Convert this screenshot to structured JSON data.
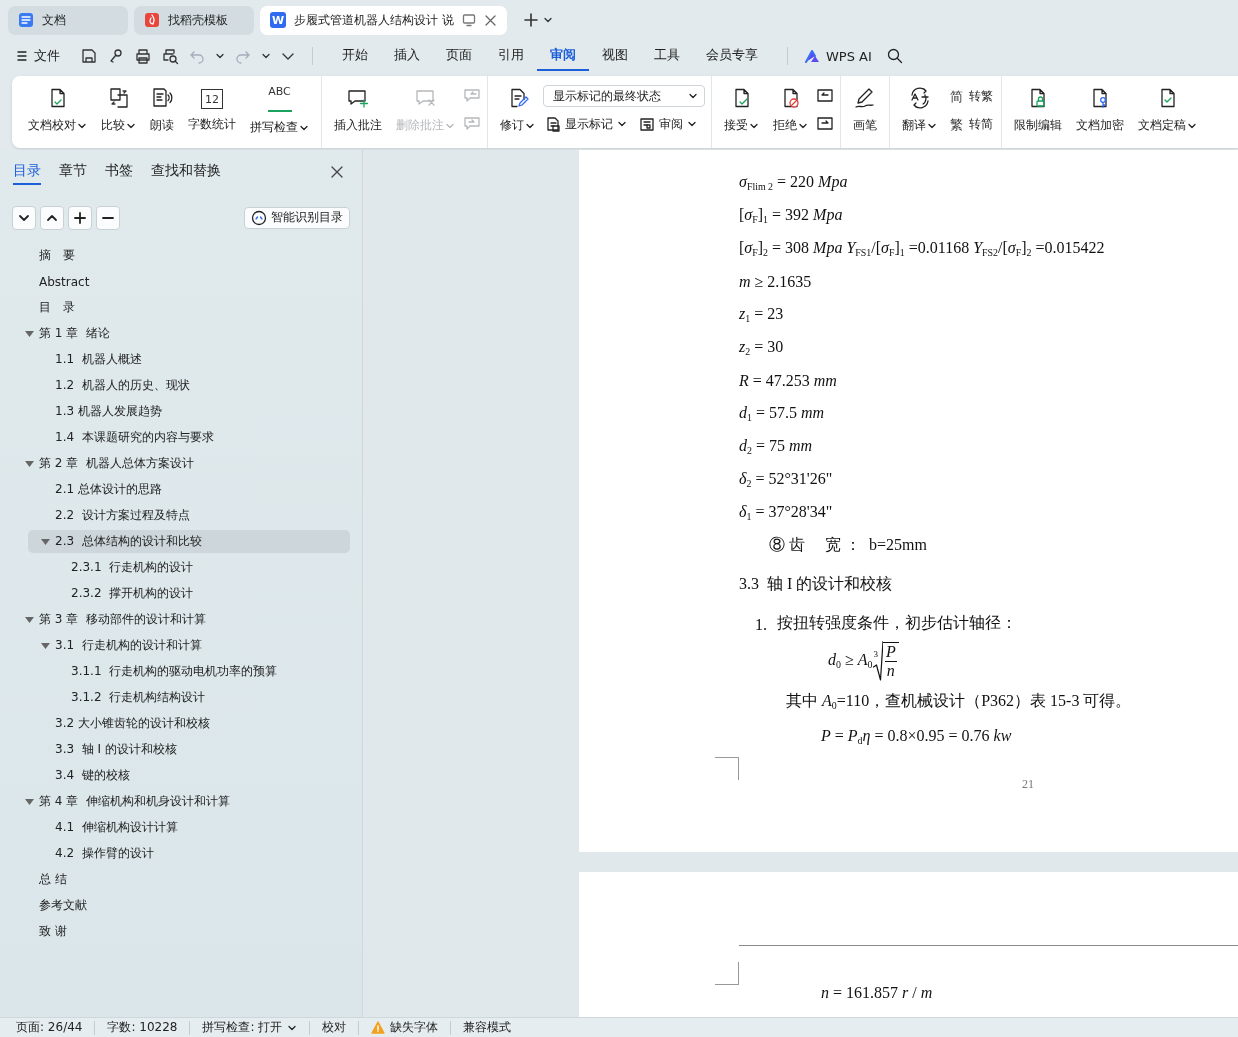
{
  "title_tabs": [
    {
      "label": "文档",
      "kind": "docs",
      "selected": false,
      "closable": false
    },
    {
      "label": "找稻壳模板",
      "kind": "template",
      "selected": false,
      "closable": false
    },
    {
      "label": "步履式管道机器人结构设计 说",
      "kind": "writer",
      "icon_text": "W",
      "selected": true,
      "closable": true
    }
  ],
  "menu": {
    "file": "文件",
    "tabs": [
      {
        "label": "开始",
        "selected": false
      },
      {
        "label": "插入",
        "selected": false
      },
      {
        "label": "页面",
        "selected": false
      },
      {
        "label": "引用",
        "selected": false
      },
      {
        "label": "审阅",
        "selected": true
      },
      {
        "label": "视图",
        "selected": false
      },
      {
        "label": "工具",
        "selected": false
      },
      {
        "label": "会员专享",
        "selected": false
      }
    ],
    "ai": "WPS AI"
  },
  "ribbon": {
    "groups": [
      {
        "items": [
          {
            "kind": "large",
            "label": "文档校对",
            "dropdown": true,
            "disabled": false
          },
          {
            "kind": "large",
            "label": "比较",
            "dropdown": true,
            "disabled": false
          },
          {
            "kind": "large",
            "label": "朗读",
            "dropdown": false,
            "disabled": false
          },
          {
            "kind": "large",
            "label": "字数统计",
            "icon_text": "12",
            "dropdown": false,
            "disabled": false
          },
          {
            "kind": "large",
            "label": "拼写检查",
            "icon_text": "ABC",
            "dropdown": true,
            "disabled": false
          }
        ]
      },
      {
        "items": [
          {
            "kind": "large",
            "label": "插入批注",
            "dropdown": false,
            "disabled": false
          },
          {
            "kind": "large",
            "label": "删除批注",
            "dropdown": true,
            "disabled": true
          },
          {
            "kind": "column",
            "rows": [
              [
                {
                  "kind": "icon",
                  "disabled": true
                }
              ],
              [
                {
                  "kind": "icon",
                  "disabled": true
                }
              ]
            ]
          }
        ]
      },
      {
        "items": [
          {
            "kind": "large",
            "label": "修订",
            "dropdown": true,
            "disabled": false
          },
          {
            "kind": "column",
            "rows": [
              [
                {
                  "kind": "select",
                  "value": "显示标记的最终状态"
                }
              ],
              [
                {
                  "kind": "small",
                  "label": "显示标记",
                  "dropdown": true,
                  "disabled": false
                },
                {
                  "kind": "small",
                  "label": "审阅",
                  "dropdown": true,
                  "disabled": false
                }
              ]
            ]
          }
        ]
      },
      {
        "items": [
          {
            "kind": "large",
            "label": "接受",
            "dropdown": true,
            "disabled": false
          },
          {
            "kind": "large",
            "label": "拒绝",
            "dropdown": true,
            "disabled": false
          },
          {
            "kind": "column",
            "rows": [
              [
                {
                  "kind": "icon",
                  "disabled": false
                }
              ],
              [
                {
                  "kind": "icon",
                  "disabled": false
                }
              ]
            ]
          }
        ]
      },
      {
        "items": [
          {
            "kind": "large",
            "label": "画笔",
            "dropdown": false,
            "disabled": false
          }
        ]
      },
      {
        "items": [
          {
            "kind": "large",
            "label": "翻译",
            "dropdown": true,
            "disabled": false
          },
          {
            "kind": "column",
            "rows": [
              [
                {
                  "kind": "small",
                  "label": "转繁",
                  "icon_text": "简",
                  "dropdown": false,
                  "disabled": false
                }
              ],
              [
                {
                  "kind": "small",
                  "label": "转简",
                  "icon_text": "繁",
                  "dropdown": false,
                  "disabled": false
                }
              ]
            ]
          }
        ]
      },
      {
        "items": [
          {
            "kind": "large",
            "label": "限制编辑",
            "dropdown": false,
            "disabled": false
          },
          {
            "kind": "large",
            "label": "文档加密",
            "dropdown": false,
            "disabled": false
          },
          {
            "kind": "large",
            "label": "文档定稿",
            "dropdown": true,
            "disabled": false
          }
        ]
      }
    ]
  },
  "sidebar": {
    "tabs": [
      {
        "label": "目录",
        "selected": true
      },
      {
        "label": "章节",
        "selected": false
      },
      {
        "label": "书签",
        "selected": false
      },
      {
        "label": "查找和替换",
        "selected": false
      }
    ],
    "smart_button": "智能识别目录",
    "toc": [
      {
        "label": "摘　要",
        "selected": false
      },
      {
        "label": "Abstract",
        "selected": false
      },
      {
        "label": "目　录",
        "selected": false
      },
      {
        "label": "第 1 章  绪论",
        "expanded": true,
        "selected": false,
        "children": [
          {
            "label": "1.1  机器人概述",
            "selected": false
          },
          {
            "label": "1.2  机器人的历史、现状",
            "selected": false
          },
          {
            "label": "1.3 机器人发展趋势",
            "selected": false
          },
          {
            "label": "1.4  本课题研究的内容与要求",
            "selected": false
          }
        ]
      },
      {
        "label": "第 2 章  机器人总体方案设计",
        "expanded": true,
        "selected": false,
        "children": [
          {
            "label": "2.1 总体设计的思路",
            "selected": false
          },
          {
            "label": "2.2  设计方案过程及特点",
            "selected": false
          },
          {
            "label": "2.3  总体结构的设计和比较",
            "expanded": true,
            "selected": true,
            "children": [
              {
                "label": "2.3.1  行走机构的设计",
                "selected": false
              },
              {
                "label": "2.3.2  撑开机构的设计",
                "selected": false
              }
            ]
          }
        ]
      },
      {
        "label": "第 3 章  移动部件的设计和计算",
        "expanded": true,
        "selected": false,
        "children": [
          {
            "label": "3.1  行走机构的设计和计算",
            "expanded": true,
            "selected": false,
            "children": [
              {
                "label": "3.1.1  行走机构的驱动电机功率的预算",
                "selected": false
              },
              {
                "label": "3.1.2  行走机构结构设计",
                "selected": false
              }
            ]
          },
          {
            "label": "3.2 大小锥齿轮的设计和校核",
            "selected": false
          },
          {
            "label": "3.3  轴 I 的设计和校核",
            "selected": false
          },
          {
            "label": "3.4  键的校核",
            "selected": false
          }
        ]
      },
      {
        "label": "第 4 章  伸缩机构和机身设计和计算",
        "expanded": true,
        "selected": false,
        "children": [
          {
            "label": "4.1  伸缩机构设计计算",
            "selected": false
          },
          {
            "label": "4.2  操作臂的设计",
            "selected": false
          }
        ]
      },
      {
        "label": "总 结",
        "selected": false
      },
      {
        "label": "参考文献",
        "selected": false
      },
      {
        "label": "致 谢",
        "selected": false
      }
    ]
  },
  "pages": [
    {
      "lines": [
        {
          "kind": "equation",
          "text": "*σ*$_{Flim 2}$ = 220 *Mpa*"
        },
        {
          "kind": "equation",
          "text": "[*σ*$_{F}$]$_{1}$ = 392 *Mpa*"
        },
        {
          "kind": "equation",
          "text": "[*σ*$_{F}$]$_{2}$ = 308 *Mpa* *Y*$_{FS1}$/[*σ*$_{F}$]$_{1}$ =0.01168 *Y*$_{FS2}$/[*σ*$_{F}$]$_{2}$ =0.015422"
        },
        {
          "kind": "equation",
          "text": "*m* ≥ 2.1635"
        },
        {
          "kind": "equation",
          "text": "*z*$_{1}$ = 23"
        },
        {
          "kind": "equation",
          "text": "*z*$_{2}$ = 30"
        },
        {
          "kind": "equation",
          "text": "*R* = 47.253 *mm*"
        },
        {
          "kind": "equation",
          "text": "*d*$_{1}$ = 57.5 *mm*"
        },
        {
          "kind": "equation",
          "text": "*d*$_{2}$ = 75 *mm*"
        },
        {
          "kind": "equation",
          "text": "*δ*$_{2}$ = 52°31'26\""
        },
        {
          "kind": "equation",
          "text": "*δ*$_{1}$ = 37°28'34\""
        },
        {
          "kind": "sub_item",
          "text": "⑧ 齿　 宽 ：  b=25mm"
        },
        {
          "kind": "heading",
          "text": "3.3  轴 I 的设计和校核"
        },
        {
          "kind": "numbered",
          "number": "1.",
          "text": "按扭转强度条件，初步估计轴径："
        },
        {
          "kind": "root_formula",
          "lhs": "*d*$_{0}$ ≥ *A*$_{0}$",
          "index": "3",
          "numerator": "P",
          "denominator": "n"
        },
        {
          "kind": "paragraph",
          "text": "其中 *A*$_{0}$=110，查机械设计（P362）表 15-3 可得。"
        },
        {
          "kind": "display_equation",
          "text": "*P* = *P*$_{d}$*η* = 0.8×0.95 = 0.76 *kw*"
        }
      ],
      "page_number": "21"
    },
    {
      "lines": [
        {
          "kind": "display_equation",
          "text": "*n* = 161.857 *r* / *m*"
        }
      ]
    }
  ],
  "status_bar": [
    {
      "kind": "text",
      "label": "页面: 26/44"
    },
    {
      "kind": "text",
      "label": "字数: 10228"
    },
    {
      "kind": "dropdown",
      "label": "拼写检查: 打开"
    },
    {
      "kind": "text",
      "label": "校对"
    },
    {
      "kind": "warning",
      "label": "缺失字体"
    },
    {
      "kind": "text",
      "label": "兼容模式"
    }
  ]
}
